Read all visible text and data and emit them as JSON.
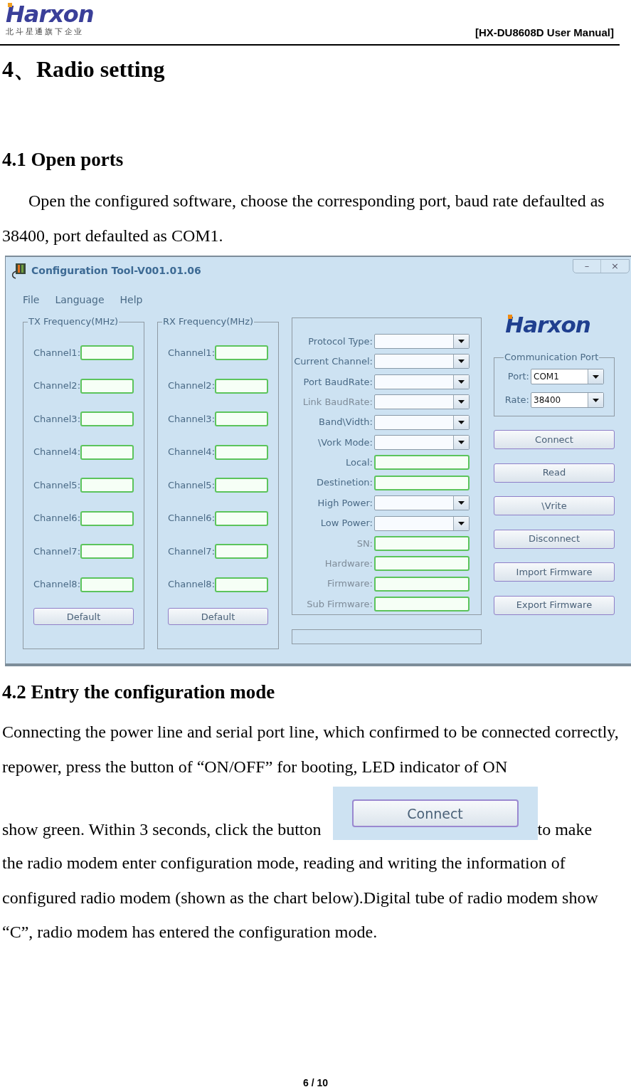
{
  "header": {
    "logo": "Harxon",
    "tagline": "北 斗 星 通 旗 下 企 业",
    "title": "[HX-DU8608D User Manual]"
  },
  "heading": "4、Radio setting",
  "section_1": {
    "heading": "4.1 Open ports",
    "paragraph": "Open the configured software, choose the corresponding port, baud rate defaulted as 38400, port defaulted as COM1."
  },
  "window": {
    "title": "Configuration Tool-V001.01.06",
    "controls": [
      "–",
      "×"
    ],
    "menu": [
      "File",
      "Language",
      "Help"
    ],
    "groups": [
      {
        "title": "TX Frequency(MHz)",
        "channels": [
          "Channel1:",
          "Channel2:",
          "Channel3:",
          "Channel4:",
          "Channel5:",
          "Channel6:",
          "Channel7:",
          "Channel8:"
        ],
        "button": "Default"
      },
      {
        "title": "RX Frequency(MHz)",
        "channels": [
          "Channel1:",
          "Channel2:",
          "Channel3:",
          "Channel4:",
          "Channel5:",
          "Channel6:",
          "Channel7:",
          "Channel8:"
        ],
        "button": "Default"
      }
    ],
    "settings": [
      {
        "label": "Protocol Type:",
        "kind": "combo",
        "disabled": false
      },
      {
        "label": "Current Channel:",
        "kind": "combo",
        "disabled": false
      },
      {
        "label": "Port BaudRate:",
        "kind": "combo",
        "disabled": false
      },
      {
        "label": "Link BaudRate:",
        "kind": "combo",
        "disabled": true
      },
      {
        "label": "Band\\Vidth:",
        "kind": "combo",
        "disabled": false
      },
      {
        "label": "\\Vork Mode:",
        "kind": "combo",
        "disabled": false
      },
      {
        "label": "Local:",
        "kind": "text",
        "disabled": false
      },
      {
        "label": "Destinetion:",
        "kind": "text",
        "disabled": false
      },
      {
        "label": "High Power:",
        "kind": "combo",
        "disabled": false
      },
      {
        "label": "Low Power:",
        "kind": "combo",
        "disabled": false
      },
      {
        "label": "SN:",
        "kind": "text",
        "disabled": true
      },
      {
        "label": "Hardware:",
        "kind": "text",
        "disabled": true
      },
      {
        "label": "Firmware:",
        "kind": "text",
        "disabled": true
      },
      {
        "label": "Sub Firmware:",
        "kind": "text",
        "disabled": true
      }
    ],
    "logo": "Harxon",
    "communication_port": {
      "title": "Communication Port",
      "fields": [
        {
          "label": "Port:",
          "value": "COM1"
        },
        {
          "label": "Rate:",
          "value": "38400"
        }
      ]
    },
    "buttons": [
      "Connect",
      "Read",
      "\\Vrite",
      "Disconnect",
      "Import Firmware",
      "Export Firmware"
    ]
  },
  "section_2": {
    "heading": "4.2 Entry the configuration mode",
    "text_1": "Connecting the power line and serial port line, which confirmed to be connected correctly, repower, press the button of “ON/OFF” for booting, LED indicator of ON",
    "text_2": "show green. Within 3 seconds, click the button",
    "inline_button": "Connect",
    "text_3": "to make",
    "text_4": "the radio modem enter configuration mode, reading and writing the information of configured radio modem (shown as the chart below).Digital tube of radio modem show “C”, radio modem has entered the configuration mode."
  },
  "page_number": "6 / 10"
}
